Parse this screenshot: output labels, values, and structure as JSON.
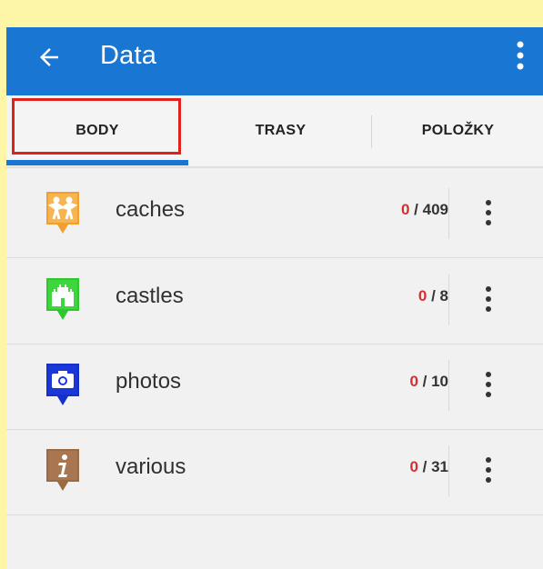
{
  "header": {
    "title": "Data"
  },
  "tabs": [
    {
      "label": "BODY",
      "selected": true
    },
    {
      "label": "TRASY",
      "selected": false
    },
    {
      "label": "POLOŽKY",
      "selected": false
    }
  ],
  "colors": {
    "appbar": "#1976d2",
    "selected_count": "#d32f2f",
    "highlight": "#e0221e"
  },
  "items": [
    {
      "name": "caches",
      "selected": "0",
      "total": " / 409",
      "icon": "caches-icon",
      "icon_color": "#f0a030"
    },
    {
      "name": "castles",
      "selected": "0",
      "total": " / 8",
      "icon": "castle-icon",
      "icon_color": "#2ec82e"
    },
    {
      "name": "photos",
      "selected": "0",
      "total": " / 10",
      "icon": "camera-icon",
      "icon_color": "#1430c8"
    },
    {
      "name": "various",
      "selected": "0",
      "total": " / 31",
      "icon": "info-icon",
      "icon_color": "#9a6a42"
    }
  ]
}
